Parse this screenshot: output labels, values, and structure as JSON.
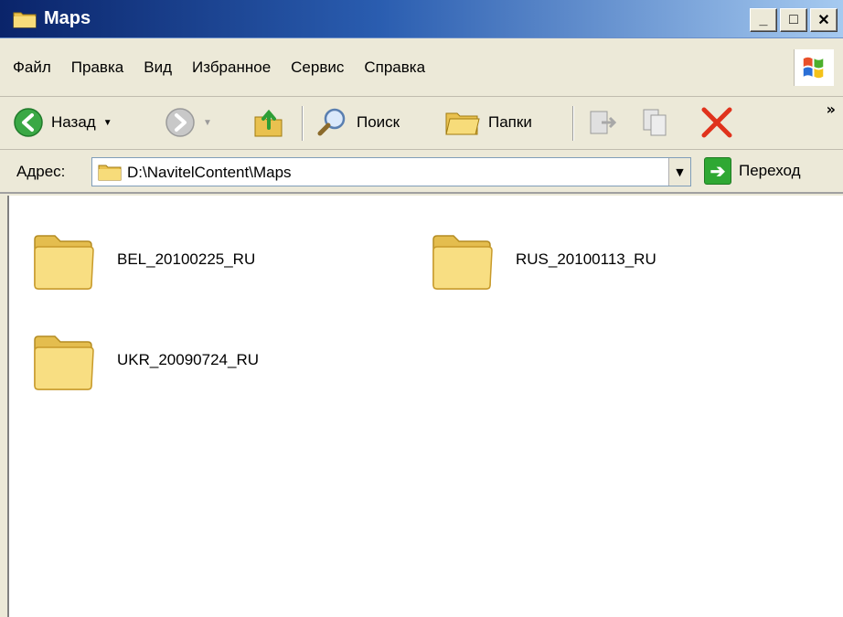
{
  "window": {
    "title": "Maps"
  },
  "menu": {
    "items": [
      "Файл",
      "Правка",
      "Вид",
      "Избранное",
      "Сервис",
      "Справка"
    ]
  },
  "toolbar": {
    "back_label": "Назад",
    "search_label": "Поиск",
    "folders_label": "Папки"
  },
  "address": {
    "label": "Адрес:",
    "value": "D:\\NavitelContent\\Maps",
    "go_label": "Переход"
  },
  "files": [
    {
      "name": "BEL_20100225_RU"
    },
    {
      "name": "RUS_20100113_RU"
    },
    {
      "name": "UKR_20090724_RU"
    }
  ],
  "colors": {
    "title_gradient_start": "#0a246a",
    "chrome": "#ece9d8",
    "folder_yellow": "#f5d46b"
  }
}
